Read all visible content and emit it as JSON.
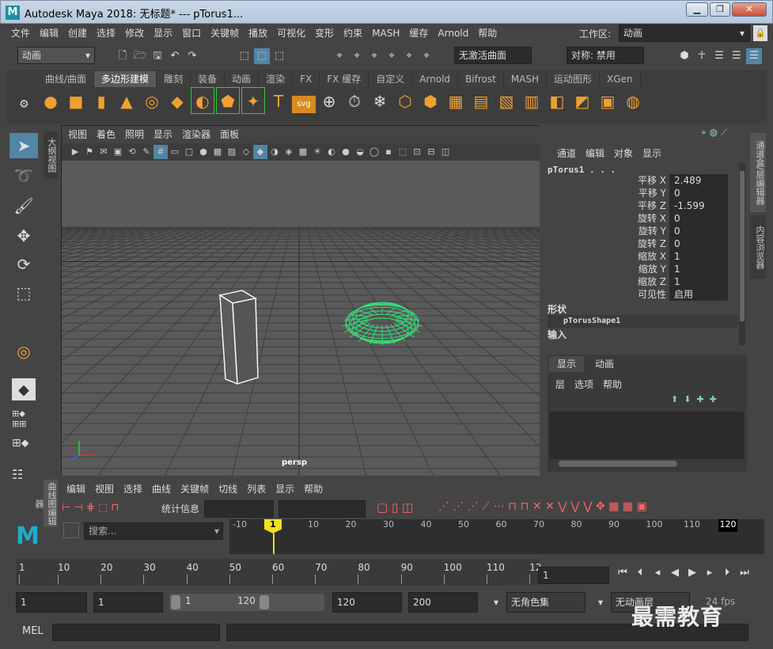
{
  "window": {
    "title": "Autodesk Maya 2018: 无标题*   ---   pTorus1...",
    "logo": "M",
    "controls": [
      "▁",
      "❐",
      "✕"
    ]
  },
  "menu": {
    "items": [
      "文件",
      "编辑",
      "创建",
      "选择",
      "修改",
      "显示",
      "窗口",
      "关键帧",
      "播放",
      "可视化",
      "变形",
      "约束",
      "MASH",
      "缓存",
      "Arnold",
      "帮助"
    ],
    "workspace_label": "工作区:",
    "workspace_value": "动画"
  },
  "statusline": {
    "mode": "动画",
    "live_surface": "无激活曲面",
    "symmetry": "对称: 禁用"
  },
  "shelf": {
    "tabs": [
      "曲线/曲面",
      "多边形建模",
      "雕刻",
      "装备",
      "动画",
      "渲染",
      "FX",
      "FX 缓存",
      "自定义",
      "Arnold",
      "Bifrost",
      "MASH",
      "运动图形",
      "XGen"
    ],
    "active_tab": "多边形建模"
  },
  "viewport": {
    "menu": [
      "视图",
      "着色",
      "照明",
      "显示",
      "渲染器",
      "面板"
    ],
    "camera_label": "persp"
  },
  "channelbox": {
    "menu": [
      "通道",
      "编辑",
      "对象",
      "显示"
    ],
    "object_name": "pTorus1 . . .",
    "attributes": [
      {
        "label": "平移 X",
        "value": "2.489"
      },
      {
        "label": "平移 Y",
        "value": "0"
      },
      {
        "label": "平移 Z",
        "value": "-1.599"
      },
      {
        "label": "旋转 X",
        "value": "0"
      },
      {
        "label": "旋转 Y",
        "value": "0"
      },
      {
        "label": "旋转 Z",
        "value": "0"
      },
      {
        "label": "缩放 X",
        "value": "1"
      },
      {
        "label": "缩放 Y",
        "value": "1"
      },
      {
        "label": "缩放 Z",
        "value": "1"
      },
      {
        "label": "可见性",
        "value": "启用"
      }
    ],
    "shape_header": "形状",
    "shape_name": "pTorusShape1",
    "input_header": "输入"
  },
  "layers": {
    "tabs": [
      "显示",
      "动画"
    ],
    "menu": [
      "层",
      "选项",
      "帮助"
    ]
  },
  "side_tabs": {
    "left_outliner": "大纲视图",
    "right_channel": "通道盒/层编辑器",
    "right_attr": "内容浏览器",
    "graph_editor": "曲线图编辑器"
  },
  "graph_editor": {
    "menu": [
      "编辑",
      "视图",
      "选择",
      "曲线",
      "关键帧",
      "切线",
      "列表",
      "显示",
      "帮助"
    ],
    "stats_label": "统计信息",
    "search_placeholder": "搜索...",
    "ruler": [
      "-10",
      "1",
      "10",
      "20",
      "30",
      "40",
      "50",
      "60",
      "70",
      "80",
      "90",
      "100",
      "110",
      "120"
    ],
    "current_marker": "1",
    "end_marker": "120"
  },
  "timeslider": {
    "ticks": [
      "1",
      "10",
      "20",
      "30",
      "40",
      "50",
      "60",
      "70",
      "80",
      "90",
      "100",
      "110",
      "12"
    ],
    "current_frame": "1"
  },
  "range": {
    "start": "1",
    "anim_start": "1",
    "slider_start": "1",
    "slider_end": "120",
    "anim_end": "120",
    "end": "200",
    "char_set": "无角色集",
    "anim_layer": "无动画层",
    "fps": "24 fps"
  },
  "mel": {
    "label": "MEL"
  },
  "watermark": "最需教育",
  "colors": {
    "selection_green": "#34e07a",
    "accent_blue": "#5285a6",
    "timeline_marker": "#f0e020"
  }
}
